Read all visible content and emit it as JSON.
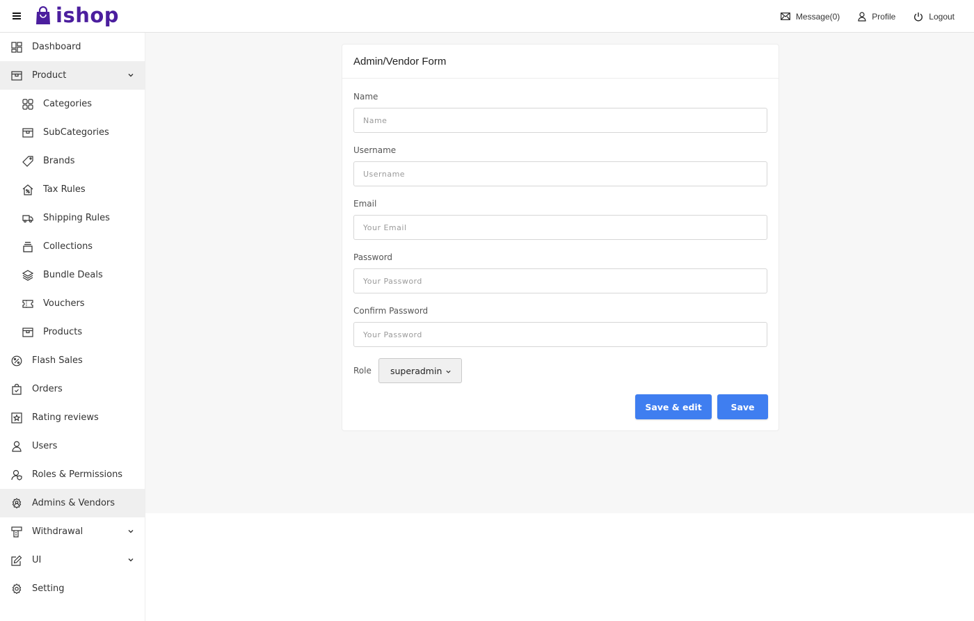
{
  "header": {
    "brand": "ishop",
    "brand_color": "#4b1e9e",
    "nav": [
      {
        "label": "Message(0)",
        "icon": "mail-icon"
      },
      {
        "label": "Profile",
        "icon": "user-icon"
      },
      {
        "label": "Logout",
        "icon": "power-icon"
      }
    ]
  },
  "sidebar": {
    "items": [
      {
        "label": "Dashboard",
        "icon": "dashboard-icon"
      },
      {
        "label": "Product",
        "icon": "box-icon",
        "expanded": true
      },
      {
        "label": "Categories",
        "icon": "grid-icon"
      },
      {
        "label": "SubCategories",
        "icon": "box-icon"
      },
      {
        "label": "Brands",
        "icon": "tag-icon"
      },
      {
        "label": "Tax Rules",
        "icon": "tax-house-icon"
      },
      {
        "label": "Shipping Rules",
        "icon": "truck-icon"
      },
      {
        "label": "Collections",
        "icon": "stack-icon"
      },
      {
        "label": "Bundle Deals",
        "icon": "layers-icon"
      },
      {
        "label": "Vouchers",
        "icon": "ticket-icon"
      },
      {
        "label": "Products",
        "icon": "box-icon"
      },
      {
        "label": "Flash Sales",
        "icon": "percent-icon"
      },
      {
        "label": "Orders",
        "icon": "bag-check-icon"
      },
      {
        "label": "Rating reviews",
        "icon": "star-box-icon"
      },
      {
        "label": "Users",
        "icon": "user-icon"
      },
      {
        "label": "Roles & Permissions",
        "icon": "shield-user-icon"
      },
      {
        "label": "Admins & Vendors",
        "icon": "user-gear-icon",
        "active": true
      },
      {
        "label": "Withdrawal",
        "icon": "withdraw-icon"
      },
      {
        "label": "UI",
        "icon": "edit-icon"
      },
      {
        "label": "Setting",
        "icon": "gear-icon"
      }
    ]
  },
  "form": {
    "title": "Admin/Vendor Form",
    "fields": [
      {
        "label": "Name",
        "placeholder": "Name",
        "value": ""
      },
      {
        "label": "Username",
        "placeholder": "Username",
        "value": ""
      },
      {
        "label": "Email",
        "placeholder": "Your Email",
        "value": ""
      },
      {
        "label": "Password",
        "placeholder": "Your Password",
        "value": ""
      },
      {
        "label": "Confirm Password",
        "placeholder": "Your Password",
        "value": ""
      }
    ],
    "role_label": "Role",
    "role_value": "superadmin",
    "save_edit_label": "Save & edit",
    "save_label": "Save",
    "accent_color": "#3f7ef0"
  }
}
